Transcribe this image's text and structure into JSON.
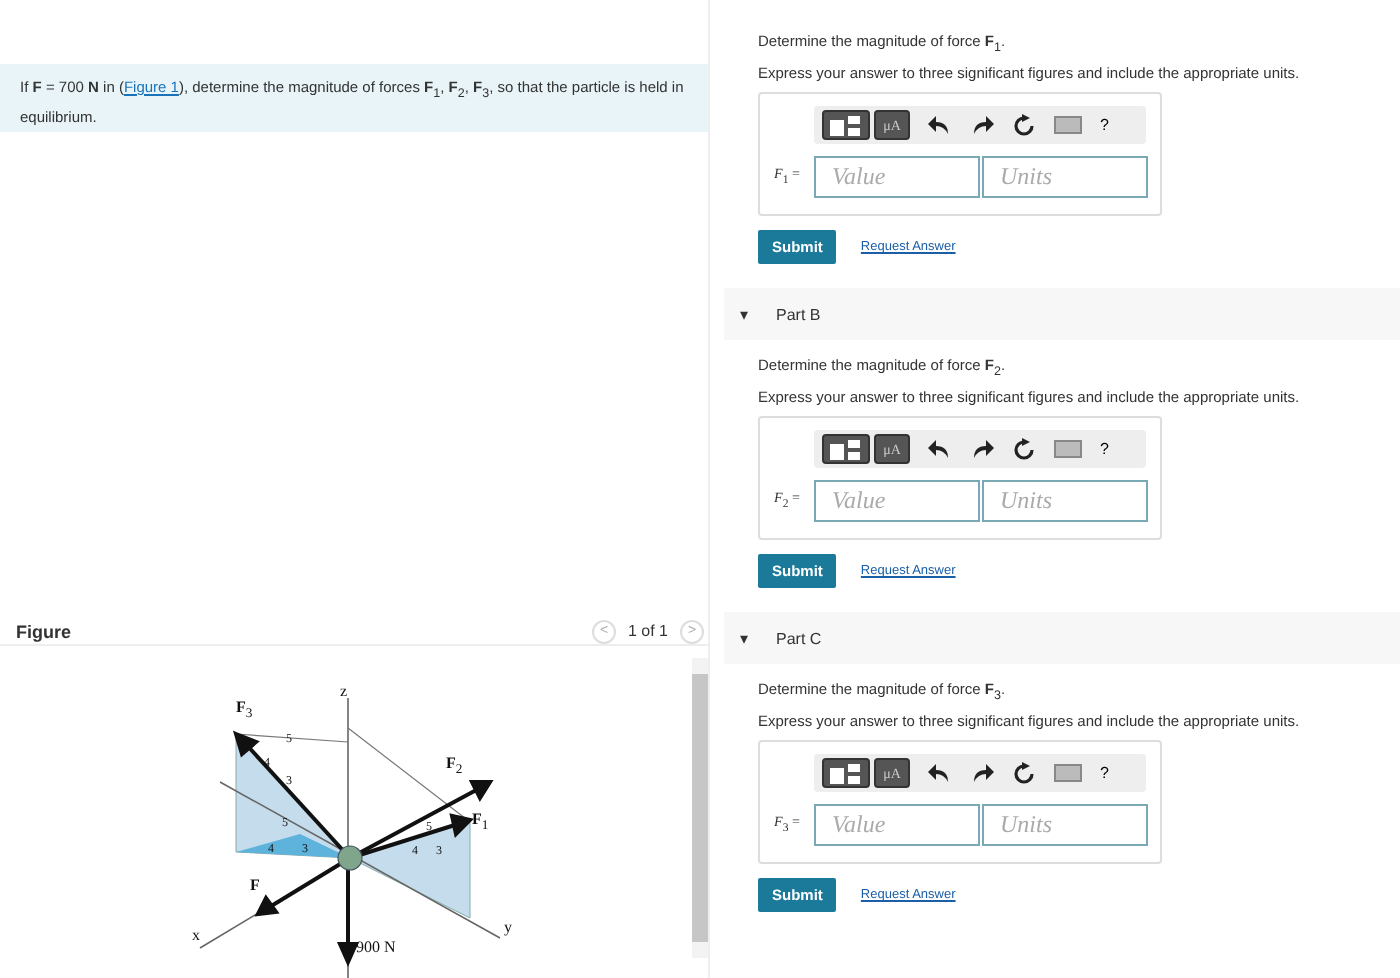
{
  "problem": {
    "before": "If **F** = 700 **N** in (",
    "link": "Figure 1",
    "after": "), determine the magnitude of forces **F**$_{1}$, **F**$_{2}$, **F**$_{3}$, so that the particle is held in equilibrium."
  },
  "figure": {
    "title": "Figure",
    "pager": "1 of 1",
    "prev": "<",
    "next": ">",
    "labels": [
      "**F**$_{3}$",
      "**F**$_{2}$",
      "**F**$_{1}$",
      "**F**",
      "z",
      "x",
      "y",
      "900 N",
      "5",
      "4",
      "3",
      "5",
      "4",
      "3",
      "5",
      "4",
      "3"
    ]
  },
  "parts": [
    {
      "question": "Determine the magnitude of force **F**$_{1}$.",
      "instruction": "Express your answer to three significant figures and include the appropriate units.",
      "unit_button": "μA",
      "help": "?",
      "label": "*F*$_{1}$ =",
      "value_placeholder": "Value",
      "units_placeholder": "Units",
      "submit": "Submit",
      "request": "Request Answer"
    },
    {
      "header": "Part B",
      "toggle": "▾",
      "expanded": true,
      "question": "Determine the magnitude of force **F**$_{2}$.",
      "instruction": "Express your answer to three significant figures and include the appropriate units.",
      "unit_button": "μA",
      "help": "?",
      "label": "*F*$_{2}$ =",
      "value_placeholder": "Value",
      "units_placeholder": "Units",
      "submit": "Submit",
      "request": "Request Answer"
    },
    {
      "header": "Part C",
      "toggle": "▾",
      "expanded": true,
      "question": "Determine the magnitude of force **F**$_{3}$.",
      "instruction": "Express your answer to three significant figures and include the appropriate units.",
      "unit_button": "μA",
      "help": "?",
      "label": "*F*$_{3}$ =",
      "value_placeholder": "Value",
      "units_placeholder": "Units",
      "submit": "Submit",
      "request": "Request Answer"
    }
  ]
}
